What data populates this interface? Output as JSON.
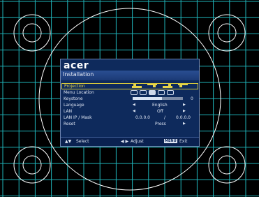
{
  "brand": "acer",
  "title": "Installation",
  "menu": {
    "projection": {
      "label": "Projection"
    },
    "menu_location": {
      "label": "Menu Location"
    },
    "keystone": {
      "label": "Keystone",
      "value": "0",
      "level": 0.58
    },
    "language": {
      "label": "Language",
      "value": "English"
    },
    "lan": {
      "label": "LAN",
      "value": "Off"
    },
    "lan_ip": {
      "label": "LAN IP / Mask",
      "ip": "0.0.0.0",
      "sep": "/",
      "mask": "0.0.0.0"
    },
    "reset": {
      "label": "Reset",
      "value": "Press"
    }
  },
  "footer": {
    "select": "Select",
    "adjust": "Adjust",
    "menu_key": "MENU",
    "exit": "Exit"
  },
  "colors": {
    "panel": "#0e2a5c",
    "highlight": "#d8c93c",
    "grid": "#1fb3b9"
  }
}
